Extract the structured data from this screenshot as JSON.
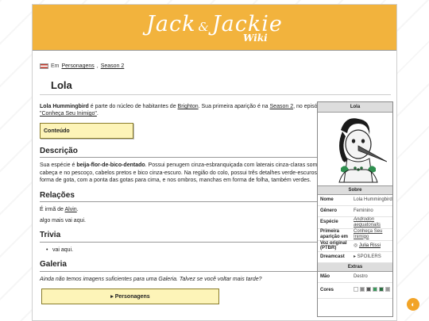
{
  "banner": {
    "logo_main": "Jack",
    "logo_amp": "&",
    "logo_second": "Jackie",
    "logo_sub": "Wiki"
  },
  "breadcrumb": {
    "prefix": "Em",
    "cat1": "Personagens",
    "sep": ",",
    "cat2": "Season 2"
  },
  "page": {
    "title": "Lola"
  },
  "intro": {
    "bold_name": "Lola Hummingbird",
    "text1": " é parte do núcleo de habitantes de ",
    "link_brighton": "Brighton",
    "text2": ". Sua primeira aparição é na ",
    "link_season": "Season 2",
    "text3": ", no episódio ",
    "link_episode": "\"Conheça Seu Inimigo\"",
    "text4": "."
  },
  "notice": {
    "label": "Conteúdo"
  },
  "sections": {
    "descricao": {
      "heading": "Descrição",
      "text1": "Sua espécie é ",
      "bold": "beija-flor-de-bico-dentado",
      "text2": ". Possui penugem cinza-esbranquiçada com laterais cinza-claras somente na cabeça e no pescoço, cabelos pretos e bico cinza-escuro. Na região do colo, possui três detalhes verde-escuros em forma de gota, com a ponta das gotas para cima, e nos ombros, manchas em forma de folha, também verdes."
    },
    "relacoes": {
      "heading": "Relações",
      "text1": "É irmã de ",
      "link": "Alvin",
      "text2": ".",
      "extra": "algo mais vai aqui."
    },
    "trivia": {
      "heading": "Trivia",
      "item": "vai aqui."
    },
    "galeria": {
      "heading": "Galeria",
      "text": "Ainda não temos imagens suficientes para uma Galeria. Talvez se você voltar mais tarde?"
    }
  },
  "collapse": {
    "label": "▸ Personagens"
  },
  "infobox": {
    "title": "Lola",
    "about_header": "Sobre",
    "rows": [
      {
        "key": "Nome",
        "value": "Lola Hummingbird"
      },
      {
        "key": "Gênero",
        "value": "Feminino"
      },
      {
        "key": "Espécie",
        "value": "Androdon aequatorialis"
      },
      {
        "key": "Primeira aparição em",
        "value": "Conheça Seu Inimigo"
      },
      {
        "key": "Voz original (PTBR)",
        "value": "Julia Rissi"
      },
      {
        "key": "Dreamcast",
        "value": "▸ SPOILERS"
      }
    ],
    "extras_header": "Extras",
    "extras": [
      {
        "key": "Mão",
        "value": "Destro"
      },
      {
        "key": "Cores",
        "value": ""
      }
    ],
    "colors": [
      "#ffffff",
      "#8a8a8a",
      "#555555",
      "#3a9a5b",
      "#2a6e40",
      "#9a9a9a"
    ]
  },
  "fab": {
    "icon": "theme-toggle-icon"
  }
}
